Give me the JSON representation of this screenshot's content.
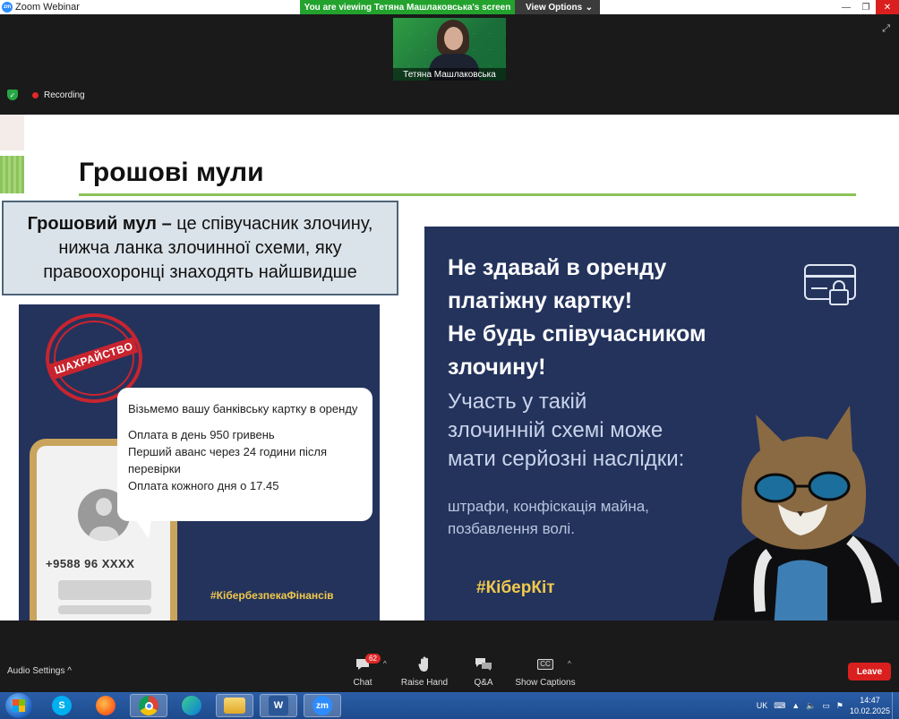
{
  "window": {
    "app_title": "Zoom Webinar",
    "viewing_banner": "You are viewing Тетяна Машлаковська's screen",
    "view_options": "View Options"
  },
  "video": {
    "participant_name": "Тетяна Машлаковська",
    "recording_label": "Recording"
  },
  "slide": {
    "title": "Грошові мули",
    "definition_bold": "Грошовий мул –",
    "definition_rest": " це співучасник злочину, нижча ланка злочинної схеми, яку правоохоронці знаходять найшвидше",
    "left_image": {
      "stamp_text": "ШАХРАЙСТВО",
      "bubble_line1": "Візьмемо вашу банківську картку в оренду",
      "bubble_line2": "Оплата в день 950 гривень",
      "bubble_line3": "Перший аванс через 24 години після перевірки",
      "bubble_line4": "Оплата кожного дня о 17.45",
      "phone_number": "+9588 96 XXXX",
      "hashtag": "#КібербезпекаФінансів"
    },
    "right_image": {
      "headline_line1": "Не здавай в оренду",
      "headline_line2": "платіжну картку!",
      "headline_line3": "Не будь співучасником",
      "headline_line4": "злочину!",
      "sub_line1": "Участь у такій",
      "sub_line2": "злочинній схемі може",
      "sub_line3": "мати серйозні наслідки:",
      "small_line1": "штрафи, конфіскація майна,",
      "small_line2": "позбавлення волі.",
      "hashtag": "#КіберКіт"
    }
  },
  "toolbar": {
    "audio_settings": "Audio Settings",
    "chat_label": "Chat",
    "chat_badge": "62",
    "raise_hand_label": "Raise Hand",
    "qa_label": "Q&A",
    "captions_label": "Show Captions",
    "cc_text": "CC",
    "leave_label": "Leave"
  },
  "taskbar": {
    "language": "UK",
    "time": "14:47",
    "date": "10.02.2025",
    "apps": [
      "skype",
      "firefox",
      "chrome",
      "edge",
      "explorer",
      "word",
      "zoom"
    ]
  },
  "colors": {
    "banner_green": "#23a22e",
    "leave_red": "#d9201e",
    "slide_navy": "#23335c",
    "accent_yellow": "#f2c94c",
    "title_line_green": "#8bc45a"
  }
}
